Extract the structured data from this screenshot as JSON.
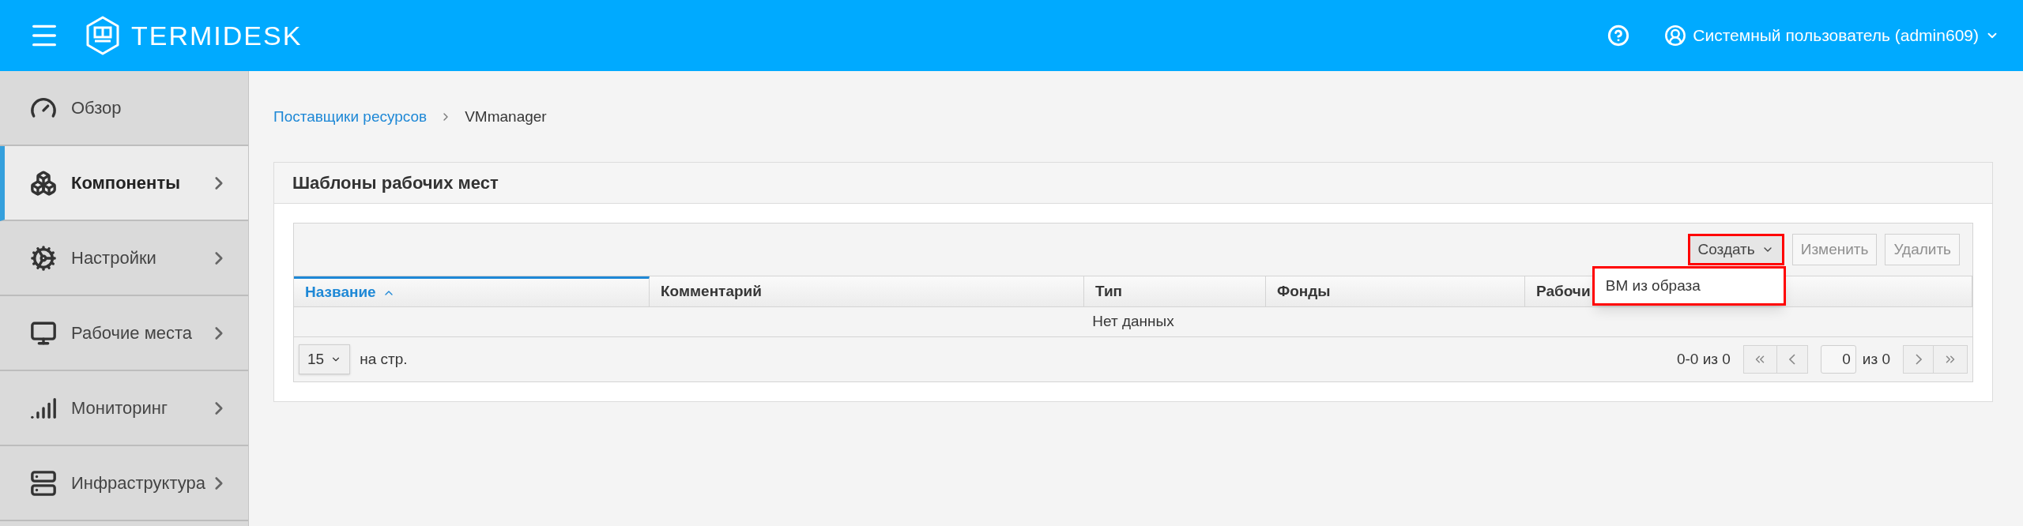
{
  "header": {
    "logo_text": "TERMIDESK",
    "user": "Системный пользователь (admin609)"
  },
  "sidebar": {
    "items": [
      {
        "label": "Обзор",
        "selected": false,
        "expandable": false
      },
      {
        "label": "Компоненты",
        "selected": true,
        "expandable": true
      },
      {
        "label": "Настройки",
        "selected": false,
        "expandable": true
      },
      {
        "label": "Рабочие места",
        "selected": false,
        "expandable": true
      },
      {
        "label": "Мониторинг",
        "selected": false,
        "expandable": true
      },
      {
        "label": "Инфраструктура",
        "selected": false,
        "expandable": true
      }
    ]
  },
  "breadcrumb": [
    {
      "label": "Поставщики ресурсов",
      "kind": "link"
    },
    {
      "label": "VMmanager",
      "kind": "current"
    }
  ],
  "panel": {
    "title": "Шаблоны рабочих мест",
    "toolbar": [
      {
        "label": "Создать",
        "kind": "dropdown",
        "disabled": false,
        "highlighted": true
      },
      {
        "label": "Изменить",
        "kind": "button",
        "disabled": true,
        "highlighted": false
      },
      {
        "label": "Удалить",
        "kind": "button",
        "disabled": true,
        "highlighted": false
      }
    ],
    "menu": {
      "highlighted": true,
      "items": [
        {
          "label": "ВМ из образа"
        }
      ]
    },
    "table": {
      "columns": [
        {
          "label": "Название",
          "selected": true
        },
        {
          "label": "Комментарий",
          "selected": false
        },
        {
          "label": "Тип",
          "selected": false
        },
        {
          "label": "Фонды",
          "selected": false
        },
        {
          "label": "Рабочи",
          "selected": false
        }
      ],
      "empty_text": "Нет данных"
    },
    "footer": {
      "page_size": "15",
      "per_page_label": "на стр.",
      "range": "0-0 из 0",
      "page": "0",
      "page_total": "из 0"
    }
  }
}
